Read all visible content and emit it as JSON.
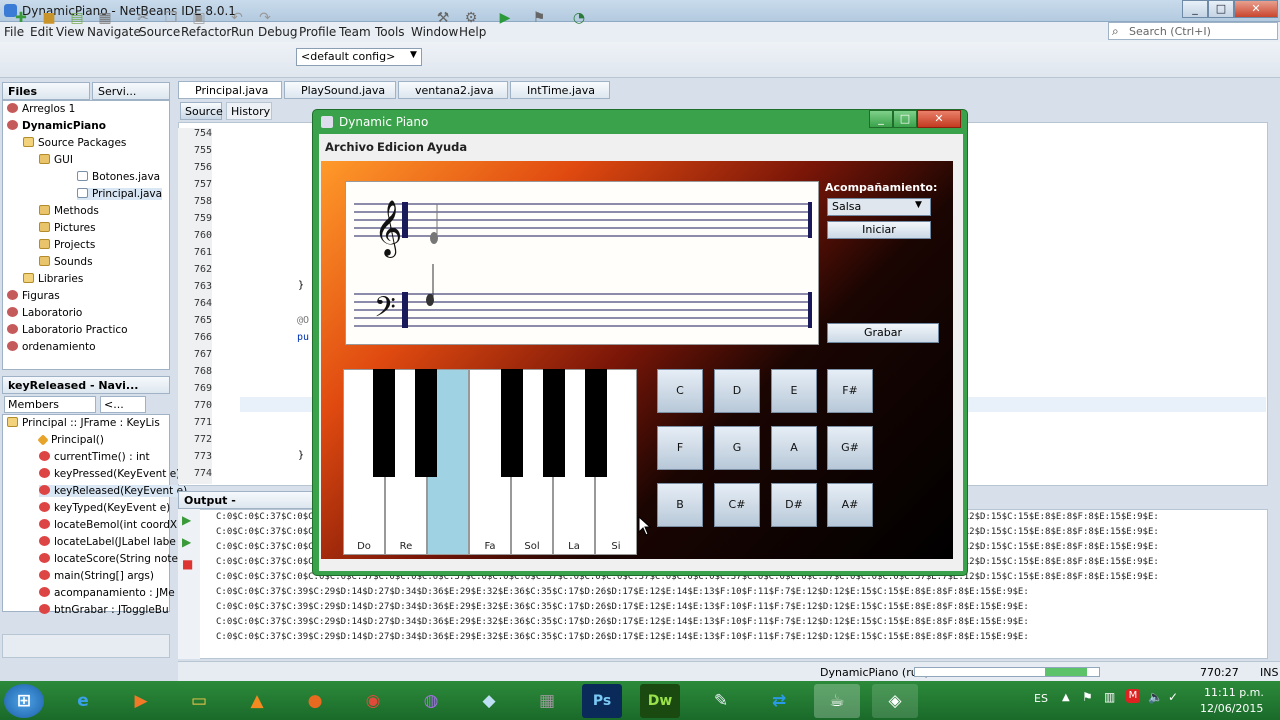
{
  "ide": {
    "title": "DynamicPiano - NetBeans IDE 8.0.1",
    "menu": [
      "File",
      "Edit",
      "View",
      "Navigate",
      "Source",
      "Refactor",
      "Run",
      "Debug",
      "Profile",
      "Team",
      "Tools",
      "Window",
      "Help"
    ],
    "config": "<default config>",
    "search_placeholder": "Search (Ctrl+I)"
  },
  "projects_panel": {
    "tab_files": "Files",
    "tab_services": "Servi...",
    "items": [
      "Arreglos 1",
      "DynamicPiano",
      "Source Packages",
      "GUI",
      "Botones.java",
      "Principal.java",
      "Methods",
      "Pictures",
      "Projects",
      "Sounds",
      "Libraries",
      "Figuras",
      "Laboratorio",
      "Laboratorio Practico",
      "ordenamiento"
    ]
  },
  "navigator": {
    "title": "keyReleased - Navi...",
    "filter": "Members",
    "filter2": "<...",
    "items": [
      "Principal :: JFrame : KeyLis",
      "Principal()",
      "currentTime() : int",
      "keyPressed(KeyEvent e)",
      "keyReleased(KeyEvent e)",
      "keyTyped(KeyEvent e)",
      "locateBemol(int coordX",
      "locateLabel(JLabel labe",
      "locateScore(String note",
      "main(String[] args)",
      "acompanamiento : JMe",
      "btnGrabar : JToggleBu"
    ]
  },
  "editor": {
    "tabs": [
      "Principal.java",
      "PlaySound.java",
      "ventana2.java",
      "IntTime.java"
    ],
    "subtabs": [
      "Source",
      "History"
    ],
    "line_numbers": [
      "754",
      "755",
      "756",
      "757",
      "758",
      "759",
      "760",
      "761",
      "762",
      "763",
      "764",
      "765",
      "766",
      "767",
      "768",
      "769",
      "770",
      "771",
      "772",
      "773",
      "774"
    ],
    "code_fragments": [
      "}",
      "@O",
      "pu",
      "}"
    ]
  },
  "output": {
    "title": "Output - DynamicPiano",
    "lines": [
      "C:0$C:0$C:37$C:0$C:0$C:0$C:37$C:0$C:0$C:0$C:37$C:0$C:0$C:0$C:37$C:0$C:0$C:0$C:37$C:0$C:0$C:0$C:37$C:0$C:0$C:0$C:37$C:0$C:0$C:0$C:37$E:7$E:12$D:15$C:15$E:8$E:8$F:8$E:15$E:9$E:",
      "C:0$C:0$C:37$C:0$C:0$C:0$C:37$C:0$C:0$C:0$C:37$C:0$C:0$C:0$C:37$C:0$C:0$C:0$C:37$C:0$C:0$C:0$C:37$C:0$C:0$C:0$C:37$C:0$C:0$C:0$C:37$E:7$E:12$D:15$C:15$E:8$E:8$F:8$E:15$E:9$E:",
      "C:0$C:0$C:37$C:0$C:0$C:0$C:37$C:0$C:0$C:0$C:37$C:0$C:0$C:0$C:37$C:0$C:0$C:0$C:37$C:0$C:0$C:0$C:37$C:0$C:0$C:0$C:37$C:0$C:0$C:0$C:37$E:7$E:12$D:15$C:15$E:8$E:8$F:8$E:15$E:9$E:",
      "C:0$C:0$C:37$C:0$C:0$C:0$C:37$C:0$C:0$C:0$C:37$C:0$C:0$C:0$C:37$C:0$C:0$C:0$C:37$C:0$C:0$C:0$C:37$C:0$C:0$C:0$C:37$C:0$C:0$C:0$C:37$E:7$E:12$D:15$C:15$E:8$E:8$F:8$E:15$E:9$E:",
      "C:0$C:0$C:37$C:0$C:0$C:0$C:37$C:0$C:0$C:0$C:37$C:0$C:0$C:0$C:37$C:0$C:0$C:0$C:37$C:0$C:0$C:0$C:37$C:0$C:0$C:0$C:37$C:0$C:0$C:0$C:37$E:7$E:12$D:15$C:15$E:8$E:8$F:8$E:15$E:9$E:",
      "C:0$C:0$C:37$C:39$C:29$D:14$D:27$D:34$D:36$E:29$E:32$E:36$C:35$C:17$D:26$D:17$E:12$E:14$E:13$F:10$F:11$F:7$E:12$D:12$E:15$C:15$E:8$E:8$F:8$E:15$E:9$E:",
      "C:0$C:0$C:37$C:39$C:29$D:14$D:27$D:34$D:36$E:29$E:32$E:36$C:35$C:17$D:26$D:17$E:12$E:14$E:13$F:10$F:11$F:7$E:12$D:12$E:15$C:15$E:8$E:8$F:8$E:15$E:9$E:",
      "C:0$C:0$C:37$C:39$C:29$D:14$D:27$D:34$D:36$E:29$E:32$E:36$C:35$C:17$D:26$D:17$E:12$E:14$E:13$F:10$F:11$F:7$E:12$D:12$E:15$C:15$E:8$E:8$F:8$E:15$E:9$E:",
      "C:0$C:0$C:37$C:39$C:29$D:14$D:27$D:34$D:36$E:29$E:32$E:36$C:35$C:17$D:26$D:17$E:12$E:14$E:13$F:10$F:11$F:7$E:12$D:12$E:15$C:15$E:8$E:8$F:8$E:15$E:9$E:"
    ]
  },
  "status": {
    "run_label": "DynamicPiano (run)",
    "position": "770:27",
    "mode": "INS"
  },
  "app": {
    "title": "Dynamic Piano",
    "menu": [
      "Archivo",
      "Edicion",
      "Ayuda"
    ],
    "acomp_label": "Acompañamiento:",
    "acomp_value": "Salsa",
    "start_button": "Iniciar",
    "record_button": "Grabar",
    "white_keys": [
      "Do",
      "Re",
      "",
      "Fa",
      "Sol",
      "La",
      "Si"
    ],
    "note_buttons": [
      "C",
      "D",
      "E",
      "F#",
      "F",
      "G",
      "A",
      "G#",
      "B",
      "C#",
      "D#",
      "A#"
    ]
  },
  "taskbar": {
    "lang": "ES",
    "time": "11:11 p.m.",
    "date": "12/06/2015"
  },
  "colors": {
    "pressed_key": "#9fd3e3",
    "taskbar": "#2c8a3a",
    "app_frame": "#3aa24a"
  }
}
